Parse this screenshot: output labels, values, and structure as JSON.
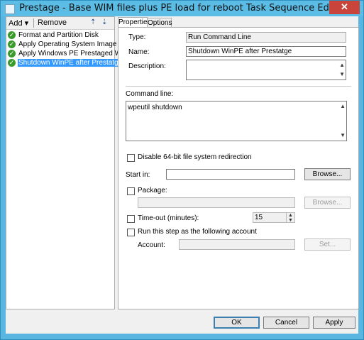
{
  "window": {
    "title": "Prestage - Base WIM files plus PE load for reboot Task Sequence Editor",
    "close_glyph": "✕"
  },
  "toolbar": {
    "add_label": "Add",
    "add_arrow": "▾",
    "remove_label": "Remove",
    "move_up_glyph": "⇡",
    "move_down_glyph": "⇣"
  },
  "steps": [
    {
      "label": "Format and Partition Disk",
      "selected": false
    },
    {
      "label": "Apply Operating System Image",
      "selected": false
    },
    {
      "label": "Apply Windows PE Prestaged WIM",
      "selected": false
    },
    {
      "label": "Shutdown WinPE after Prestatge",
      "selected": true
    }
  ],
  "tabs": [
    {
      "label": "Properties",
      "active": true
    },
    {
      "label": "Options",
      "active": false
    }
  ],
  "properties": {
    "type_label": "Type:",
    "type_value": "Run Command Line",
    "name_label": "Name:",
    "name_value": "Shutdown WinPE after Prestatge",
    "description_label": "Description:",
    "description_value": "",
    "command_line_label": "Command line:",
    "command_line_value": "wpeutil shutdown",
    "disable_redirection_label": "Disable 64-bit file system redirection",
    "disable_redirection_checked": false,
    "start_in_label": "Start in:",
    "start_in_value": "",
    "browse_label": "Browse...",
    "package_label": "Package:",
    "package_checked": false,
    "package_value": "",
    "package_browse_label": "Browse...",
    "timeout_label": "Time-out (minutes):",
    "timeout_checked": false,
    "timeout_value": "15",
    "run_as_label": "Run this step as the following account",
    "run_as_checked": false,
    "account_label": "Account:",
    "account_value": "",
    "set_label": "Set..."
  },
  "buttons": {
    "ok": "OK",
    "cancel": "Cancel",
    "apply": "Apply"
  },
  "colors": {
    "titlebar": "#5bbde6",
    "selection": "#3399ff",
    "check": "#3a9b2c",
    "close": "#c9453b"
  }
}
